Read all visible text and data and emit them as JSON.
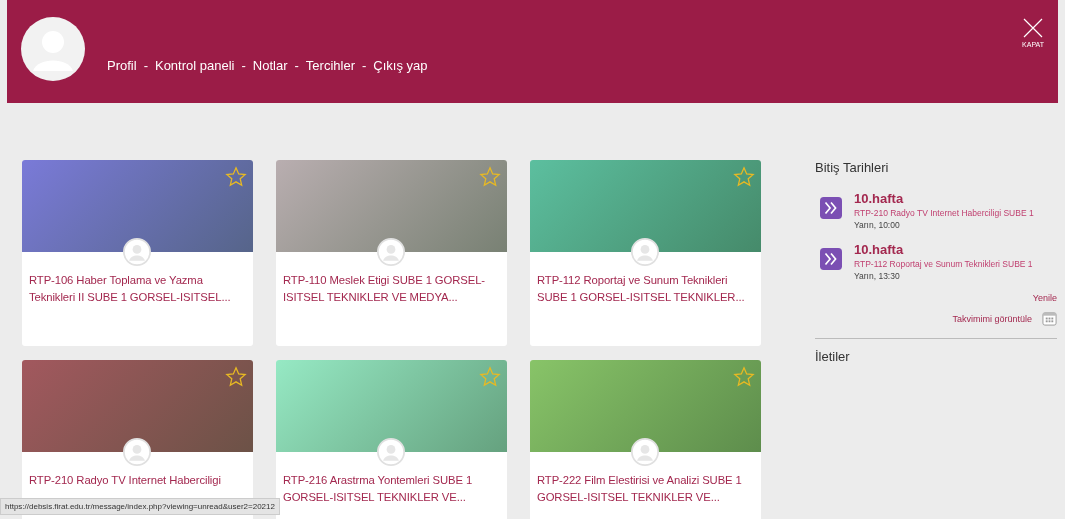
{
  "header": {
    "nav": [
      "Profil",
      "Kontrol paneli",
      "Notlar",
      "Tercihler",
      "Çıkış yap"
    ],
    "separator": "-",
    "close_label": "KAPAT"
  },
  "courses": [
    {
      "title": "RTP-106 Haber Toplama ve Yazma Teknikleri II SUBE 1 GORSEL-ISITSEL...",
      "starred": false,
      "color": "#7a7ad8"
    },
    {
      "title": "RTP-110 Meslek Etigi SUBE 1 GORSEL-ISITSEL TEKNIKLER VE MEDYA...",
      "starred": false,
      "color": "#b9aeb0"
    },
    {
      "title": "RTP-112 Roportaj ve Sunum Teknikleri SUBE 1 GORSEL-ISITSEL TEKNIKLER...",
      "starred": false,
      "color": "#5cbf9f"
    },
    {
      "title": "RTP-210 Radyo TV Internet Haberciligi",
      "starred": false,
      "color": "#a2585e"
    },
    {
      "title": "RTP-216 Arastrma Yontemleri SUBE 1 GORSEL-ISITSEL TEKNIKLER VE...",
      "starred": false,
      "color": "#96e9c4"
    },
    {
      "title": "RTP-222 Film Elestirisi ve Analizi SUBE 1 GORSEL-ISITSEL TEKNIKLER VE...",
      "starred": false,
      "color": "#88c468"
    }
  ],
  "deadlines": {
    "title": "Bitiş Tarihleri",
    "events": [
      {
        "name": "10.hafta",
        "course": "RTP-210 Radyo TV Internet Haberciligi SUBE 1",
        "time": "Yarın, 10:00"
      },
      {
        "name": "10.hafta",
        "course": "RTP-112 Roportaj ve Sunum Teknikleri SUBE 1",
        "time": "Yarın, 13:30"
      }
    ],
    "refresh": "Yenile",
    "calendar_link": "Takvimimi görüntüle"
  },
  "messages": {
    "title": "İletiler"
  },
  "status_url": "https://debsis.firat.edu.tr/message/index.php?viewing=unread&user2=20212"
}
